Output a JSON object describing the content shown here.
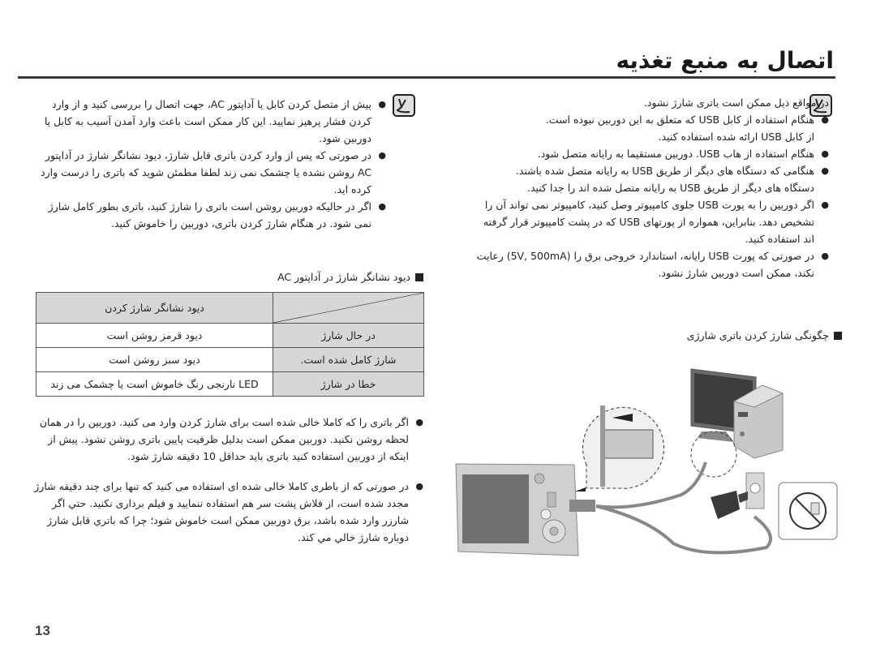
{
  "page": {
    "title": "اتصال به منبع تغذیه",
    "page_number": "13"
  },
  "right_note": {
    "icon": "note-pencil-icon",
    "intro": "در مواقع ذیل ممکن است باتری شارژ نشود.",
    "items": [
      {
        "bullet": true,
        "text": "هنگام استفاده از کابل USB که متعلق به این دوربین نبوده است."
      },
      {
        "bullet": false,
        "text": "از کابل USB ارائه شده استفاده کنید."
      },
      {
        "bullet": true,
        "text": "هنگام استفاده از هاب USB. دوربین مستقیما به رایانه متصل شود."
      },
      {
        "bullet": true,
        "text": "هنگامی که دستگاه های دیگر از طریق USB به رایانه متصل شده باشند."
      },
      {
        "bullet": false,
        "text": "دستگاه های دیگر از طریق USB به رایانه متصل شده اند را جدا کنید."
      },
      {
        "bullet": true,
        "text": "اگر دوربین را به پورت USB جلوی کامپیوتر وصل کنید، کامپیوتر نمی تواند آن را تشخیص دهد. بنابراین، همواره از پورتهای USB که در پشت کامپیوتر قرار گرفته اند استفاده کنید."
      },
      {
        "bullet": true,
        "text": "در صورتی که پورت USB رایانه، استاندارد خروجی برق را (5V, 500mA) رعایت نکند، ممکن است دوربین شارژ نشود."
      }
    ]
  },
  "left_note": {
    "icon": "note-pencil-icon",
    "items": [
      {
        "bullet": true,
        "text": "پیش از متصل کردن کابل یا آداپتور AC، جهت اتصال را بررسی کنید و از وارد کردن فشار پرهیز نمایید. این کار ممکن است باعث وارد آمدن آسیب به کابل یا دوربین شود."
      },
      {
        "bullet": true,
        "text": "در صورتی که پس از وارد کردن باتری قابل شارژ، دیود نشانگر شارژ در آداپتور AC روشن نشده یا چشمک نمی زند لطفا مطمئن شوید که باتری را درست وارد کرده اید."
      },
      {
        "bullet": true,
        "text": "اگر در حالیکه دوربین روشن است باتری را شارژ کنید، باتری بطور کامل شارژ نمی شود. در هنگام شارژ کردن باتری، دوربین را خاموش کنید."
      }
    ]
  },
  "led_section": {
    "heading": "دیود نشانگر شارژ در آداپتور AC",
    "table": {
      "header": "دیود نشانگر شارژ کردن",
      "rows": [
        {
          "label": "در حال شارژ",
          "value": "دیود قرمز روشن است"
        },
        {
          "label": "شارژ کامل شده است.",
          "value": "دیود سبز روشن است"
        },
        {
          "label": "خطا در شارژ",
          "value": "LED نارنجی رنگ خاموش است یا چشمک می زند"
        }
      ]
    }
  },
  "bottom_notes": [
    "اگر باتری را که کاملا خالی شده است برای شارژ کردن وارد می کنید. دوربین را در همان لحظه روشن نکنید. دوربین ممکن است بدلیل ظرفیت پایین باتری روشن نشود. پیش از اینکه از دوربین استفاده کنید باتری باید حداقل 10 دقیقه شارژ شود.",
    "در صورتی که از باطری کاملا خالی شده ای استفاده می کنید که تنها برای چند دقیقه شارژ مجدد شده است، از فلاش پشت سر هم استفاده ننمایید و فیلم برداری نکنید. حتي اگر شارزر وارد شده باشد، برق دوربین ممکن است خاموش شود؛ چرا که باتري قابل شارژ دوباره شارژ خالي مي کند."
  ],
  "charging_section": {
    "heading": "چگونگی شارژ کردن باتری شارژی"
  }
}
